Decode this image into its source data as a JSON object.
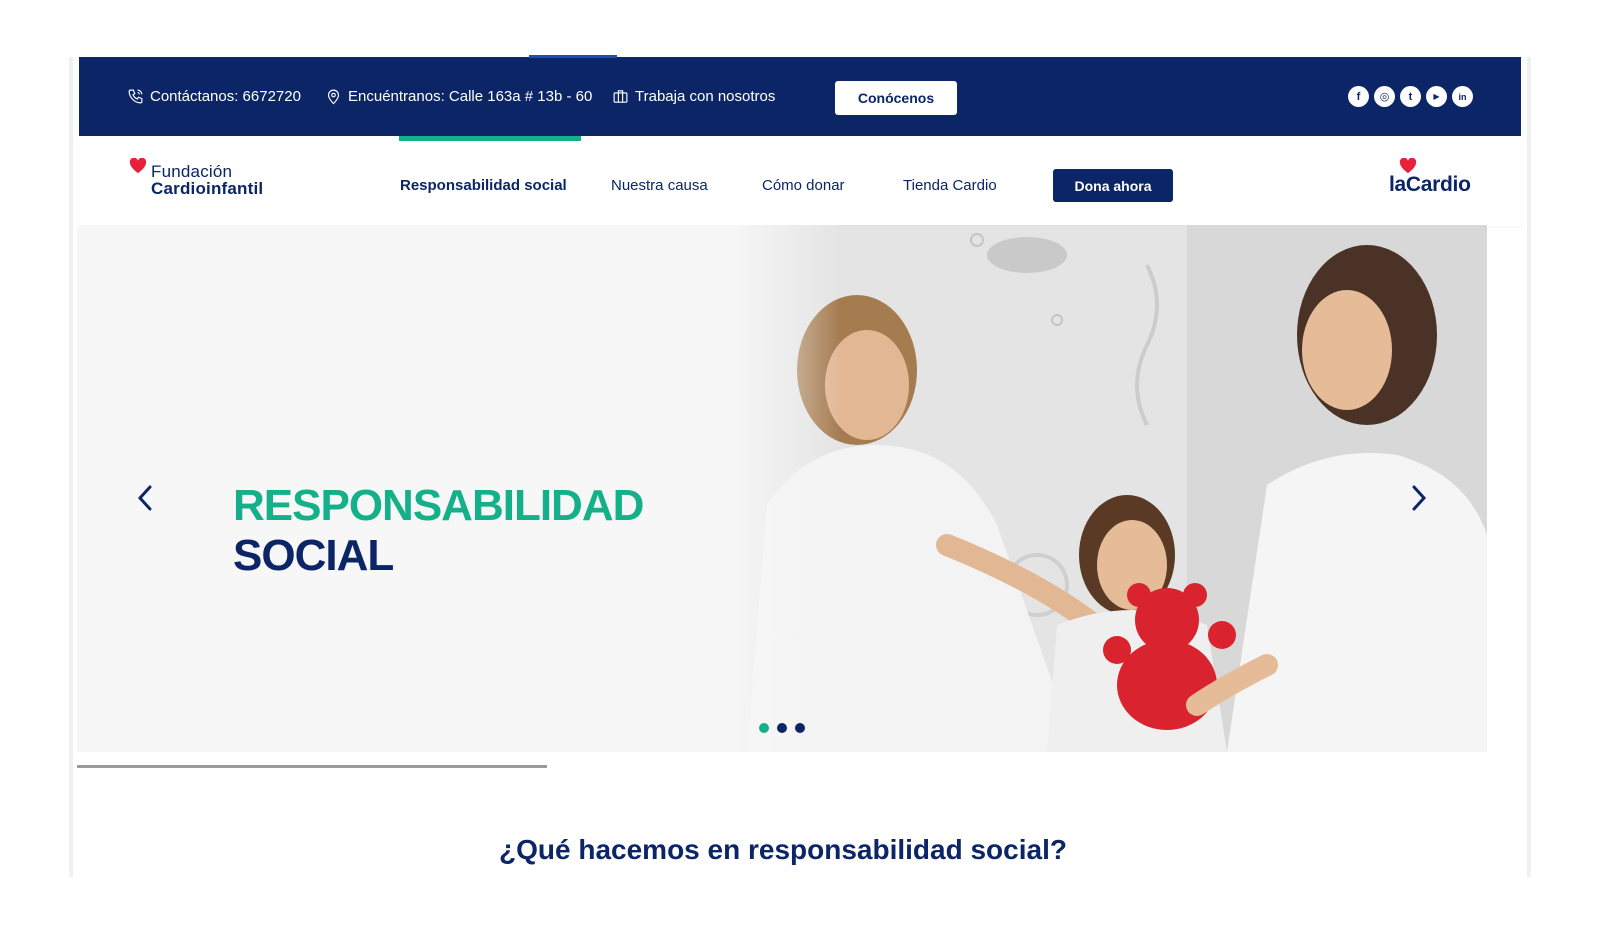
{
  "topbar": {
    "contact": "Contáctanos: 6672720",
    "location": "Encuéntranos: Calle 163a # 13b - 60",
    "work": "Trabaja con nosotros",
    "cta": "Conócenos",
    "socials": [
      {
        "icon": "facebook-icon",
        "glyph": "f"
      },
      {
        "icon": "instagram-icon",
        "glyph": "◎"
      },
      {
        "icon": "twitter-icon",
        "glyph": "t"
      },
      {
        "icon": "youtube-icon",
        "glyph": "▶"
      },
      {
        "icon": "linkedin-icon",
        "glyph": "in"
      }
    ]
  },
  "nav": {
    "brand_left_line1": "Fundación",
    "brand_left_line2": "Cardioinfantil",
    "items": [
      "Responsabilidad social",
      "Nuestra causa",
      "Cómo donar",
      "Tienda Cardio"
    ],
    "active_index": 0,
    "donate": "Dona ahora",
    "brand_right": "laCardio"
  },
  "hero": {
    "title_line1": "RESPONSABILIDAD",
    "title_line2": "SOCIAL",
    "slides": 3,
    "active_slide": 0
  },
  "section": {
    "title": "¿Qué hacemos en responsabilidad social?"
  },
  "colors": {
    "navy": "#0b2566",
    "green": "#14b08a",
    "heart": "#e8203a"
  }
}
